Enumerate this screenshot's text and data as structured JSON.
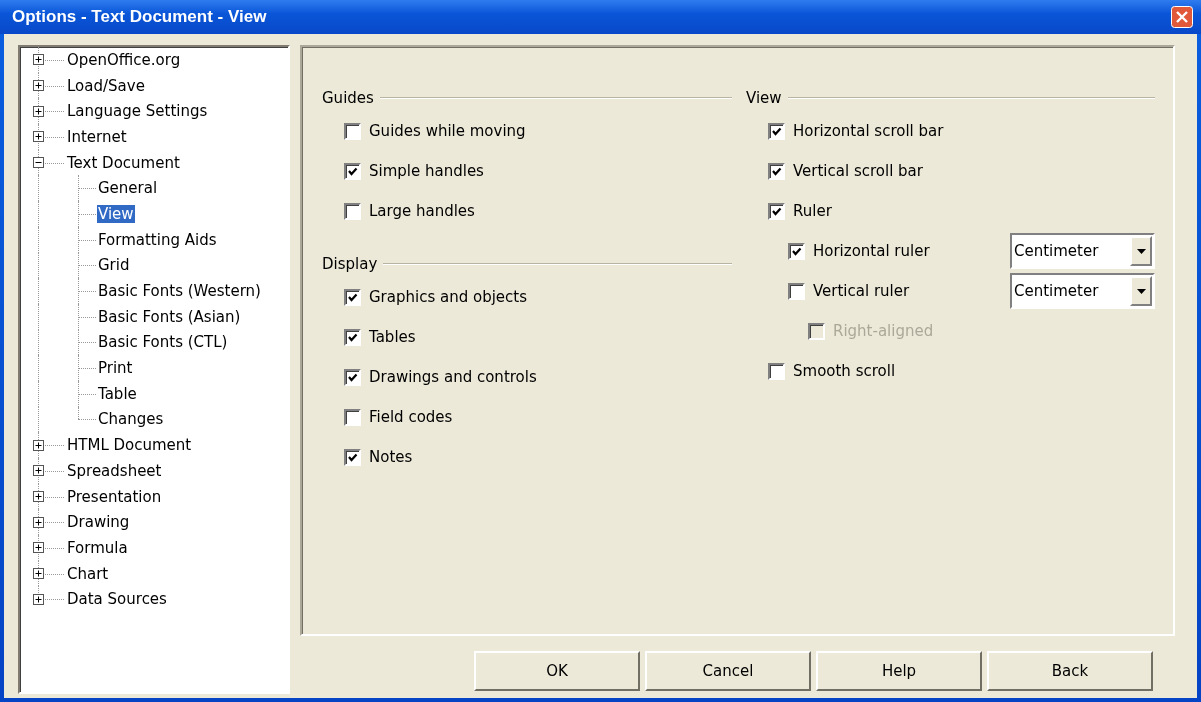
{
  "window": {
    "title": "Options - Text Document - View"
  },
  "tree": [
    {
      "label": "OpenOffice.org",
      "expanded": false,
      "selected": false
    },
    {
      "label": "Load/Save",
      "expanded": false,
      "selected": false
    },
    {
      "label": "Language Settings",
      "expanded": false,
      "selected": false
    },
    {
      "label": "Internet",
      "expanded": false,
      "selected": false
    },
    {
      "label": "Text Document",
      "expanded": true,
      "selected": false,
      "children": [
        {
          "label": "General",
          "selected": false
        },
        {
          "label": "View",
          "selected": true
        },
        {
          "label": "Formatting Aids",
          "selected": false
        },
        {
          "label": "Grid",
          "selected": false
        },
        {
          "label": "Basic Fonts (Western)",
          "selected": false
        },
        {
          "label": "Basic Fonts (Asian)",
          "selected": false
        },
        {
          "label": "Basic Fonts (CTL)",
          "selected": false
        },
        {
          "label": "Print",
          "selected": false
        },
        {
          "label": "Table",
          "selected": false
        },
        {
          "label": "Changes",
          "selected": false
        }
      ]
    },
    {
      "label": "HTML Document",
      "expanded": false,
      "selected": false
    },
    {
      "label": "Spreadsheet",
      "expanded": false,
      "selected": false
    },
    {
      "label": "Presentation",
      "expanded": false,
      "selected": false
    },
    {
      "label": "Drawing",
      "expanded": false,
      "selected": false
    },
    {
      "label": "Formula",
      "expanded": false,
      "selected": false
    },
    {
      "label": "Chart",
      "expanded": false,
      "selected": false
    },
    {
      "label": "Data Sources",
      "expanded": false,
      "selected": false
    }
  ],
  "guides": {
    "title": "Guides",
    "options": [
      {
        "label": "Guides while moving",
        "checked": false
      },
      {
        "label": "Simple handles",
        "checked": true
      },
      {
        "label": "Large handles",
        "checked": false
      }
    ]
  },
  "display": {
    "title": "Display",
    "options": [
      {
        "label": "Graphics and objects",
        "checked": true
      },
      {
        "label": "Tables",
        "checked": true
      },
      {
        "label": "Drawings and controls",
        "checked": true
      },
      {
        "label": "Field codes",
        "checked": false
      },
      {
        "label": "Notes",
        "checked": true
      }
    ]
  },
  "view": {
    "title": "View",
    "options": [
      {
        "label": "Horizontal scroll bar",
        "checked": true,
        "disabled": false
      },
      {
        "label": "Vertical scroll bar",
        "checked": true,
        "disabled": false
      },
      {
        "label": "Ruler",
        "checked": true,
        "disabled": false,
        "children": [
          {
            "label": "Horizontal ruler",
            "checked": true,
            "disabled": false,
            "unit": "Centimeter"
          },
          {
            "label": "Vertical ruler",
            "checked": false,
            "disabled": false,
            "unit": "Centimeter",
            "children": [
              {
                "label": "Right-aligned",
                "checked": false,
                "disabled": true
              }
            ]
          }
        ]
      },
      {
        "label": "Smooth scroll",
        "checked": false,
        "disabled": false
      }
    ]
  },
  "buttons": [
    "OK",
    "Cancel",
    "Help",
    "Back"
  ]
}
